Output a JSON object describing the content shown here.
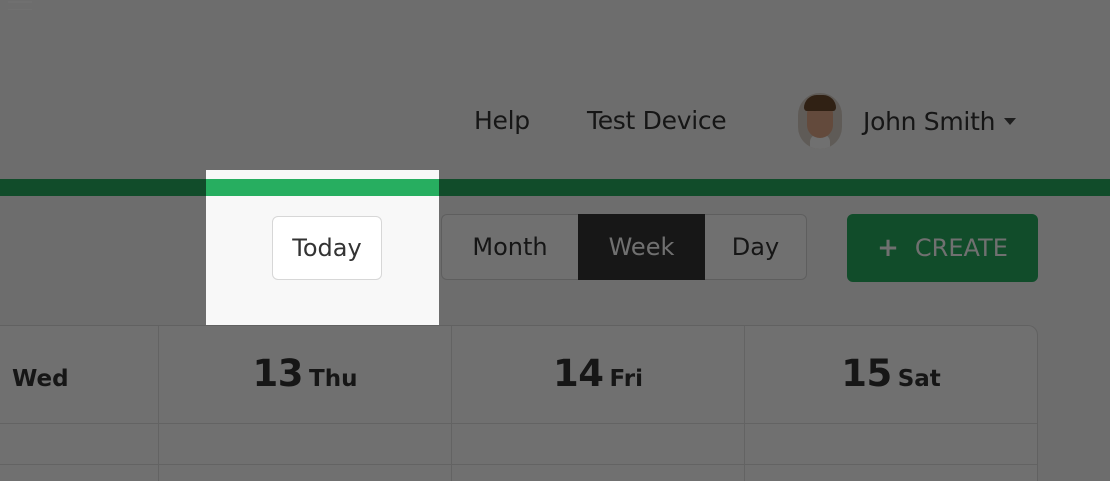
{
  "header": {
    "links": {
      "help": "Help",
      "test_device": "Test Device"
    },
    "user": {
      "name": "John Smith"
    }
  },
  "toolbar": {
    "today_label": "Today",
    "view_switcher": {
      "month": "Month",
      "week": "Week",
      "day": "Day",
      "active": "Week"
    },
    "create_label": "CREATE",
    "create_icon": "+"
  },
  "calendar": {
    "partial_day": "Wed",
    "days": [
      {
        "date": "13",
        "weekday": "Thu"
      },
      {
        "date": "14",
        "weekday": "Fri"
      },
      {
        "date": "15",
        "weekday": "Sat"
      }
    ]
  },
  "colors": {
    "brand_green": "#27ae60",
    "active_segment": "#353535",
    "dim_overlay": "rgba(0,0,0,0.56)"
  }
}
